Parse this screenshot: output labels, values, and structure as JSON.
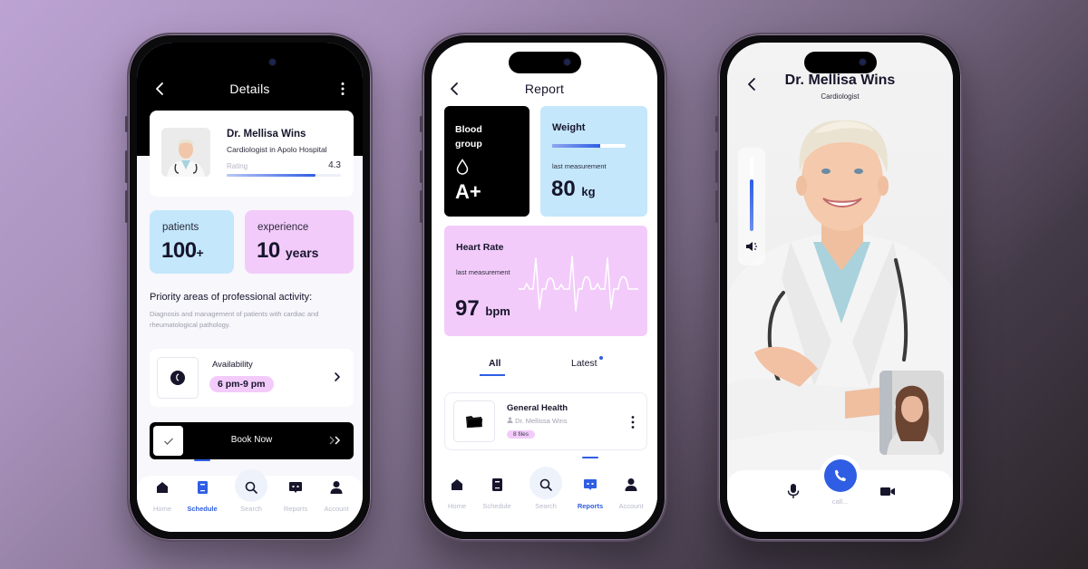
{
  "colors": {
    "accent": "#2f5ee4",
    "card_blue": "#c4e7fb",
    "card_pink": "#f3cbfa",
    "dark_text": "#16152b",
    "muted_text": "#b9bccb"
  },
  "details_screen": {
    "header": {
      "title": "Details",
      "back_icon": "chevron-left-icon",
      "more_icon": "vertical-dots-icon"
    },
    "doctor": {
      "name": "Dr. Mellisa Wins",
      "specialty": "Cardiologist in Apolo Hospital",
      "rating_label": "Rating",
      "rating_value": "4.3",
      "rating_fraction": 0.78
    },
    "stats": [
      {
        "label": "patients",
        "value": "100",
        "unit": "+"
      },
      {
        "label": "experience",
        "value": "10",
        "unit": "years"
      }
    ],
    "priority": {
      "title": "Priority areas of professional activity:",
      "description": "Diagnosis and management of patients with cardiac and rheumatological pathology."
    },
    "availability": {
      "label": "Availability",
      "time": "6 pm-9 pm",
      "icon": "clock-icon"
    },
    "book_button": {
      "label": "Book Now",
      "check_icon": "check-icon",
      "arrow_icon": "double-chevron-right-icon"
    },
    "tabbar": {
      "active": "Schedule",
      "items": [
        {
          "label": "Home",
          "icon": "home-icon"
        },
        {
          "label": "Schedule",
          "icon": "schedule-book-icon"
        },
        {
          "label": "Search",
          "icon": "search-icon"
        },
        {
          "label": "Reports",
          "icon": "reports-chat-icon"
        },
        {
          "label": "Account",
          "icon": "account-icon"
        }
      ]
    }
  },
  "report_screen": {
    "header": {
      "title": "Report",
      "back_icon": "chevron-left-icon"
    },
    "blood_group": {
      "title": "Blood group",
      "value": "A+",
      "icon": "blood-drop-icon"
    },
    "weight": {
      "title": "Weight",
      "subtitle": "last measurement",
      "value": "80",
      "unit": "kg",
      "bar_fraction": 0.66
    },
    "heart_rate": {
      "title": "Heart Rate",
      "subtitle": "last measurement",
      "value": "97",
      "unit": "bpm",
      "icon": "ecg-waveform-icon"
    },
    "segments": {
      "active": "All",
      "items": [
        {
          "label": "All",
          "has_dot": false
        },
        {
          "label": "Latest",
          "has_dot": true
        }
      ]
    },
    "file": {
      "title": "General Health",
      "author": "Dr. Mellissa Wins",
      "count_label": "8 files",
      "icon": "folder-icon"
    },
    "tabbar": {
      "active": "Reports",
      "items": [
        {
          "label": "Home",
          "icon": "home-icon"
        },
        {
          "label": "Schedule",
          "icon": "schedule-book-icon"
        },
        {
          "label": "Search",
          "icon": "search-icon"
        },
        {
          "label": "Reports",
          "icon": "reports-chat-icon"
        },
        {
          "label": "Account",
          "icon": "account-icon"
        }
      ]
    }
  },
  "call_screen": {
    "header": {
      "name": "Dr. Mellisa Wins",
      "subtitle": "Cardiologist",
      "back_icon": "chevron-left-icon"
    },
    "volume_fraction": 0.7,
    "controls": {
      "mic_icon": "microphone-icon",
      "call_icon": "phone-icon",
      "video_icon": "video-camera-icon",
      "call_label": "call..."
    }
  }
}
